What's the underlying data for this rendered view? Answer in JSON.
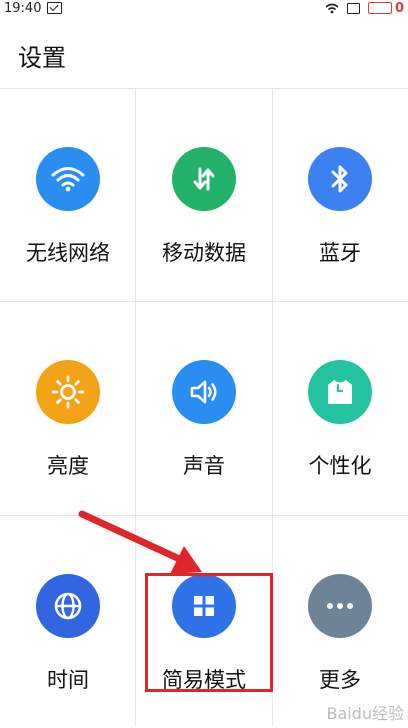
{
  "status_bar": {
    "time": "19:40",
    "battery": "0"
  },
  "header": {
    "title": "设置"
  },
  "tiles": [
    {
      "label": "无线网络",
      "color": "#2a8df0",
      "icon": "wifi-icon"
    },
    {
      "label": "移动数据",
      "color": "#23b26a",
      "icon": "data-transfer-icon"
    },
    {
      "label": "蓝牙",
      "color": "#3b82f0",
      "icon": "bluetooth-icon"
    },
    {
      "label": "亮度",
      "color": "#f5a316",
      "icon": "sun-icon"
    },
    {
      "label": "声音",
      "color": "#2a8df0",
      "icon": "speaker-icon"
    },
    {
      "label": "个性化",
      "color": "#23c3a2",
      "icon": "shirt-icon"
    },
    {
      "label": "时间",
      "color": "#3166e0",
      "icon": "globe-icon"
    },
    {
      "label": "简易模式",
      "color": "#3073e8",
      "icon": "grid-icon"
    },
    {
      "label": "更多",
      "color": "#6d8498",
      "icon": "more-icon"
    }
  ],
  "annotation": {
    "highlight_color": "#e0262c"
  },
  "watermark": {
    "text": "Baidu经验"
  }
}
